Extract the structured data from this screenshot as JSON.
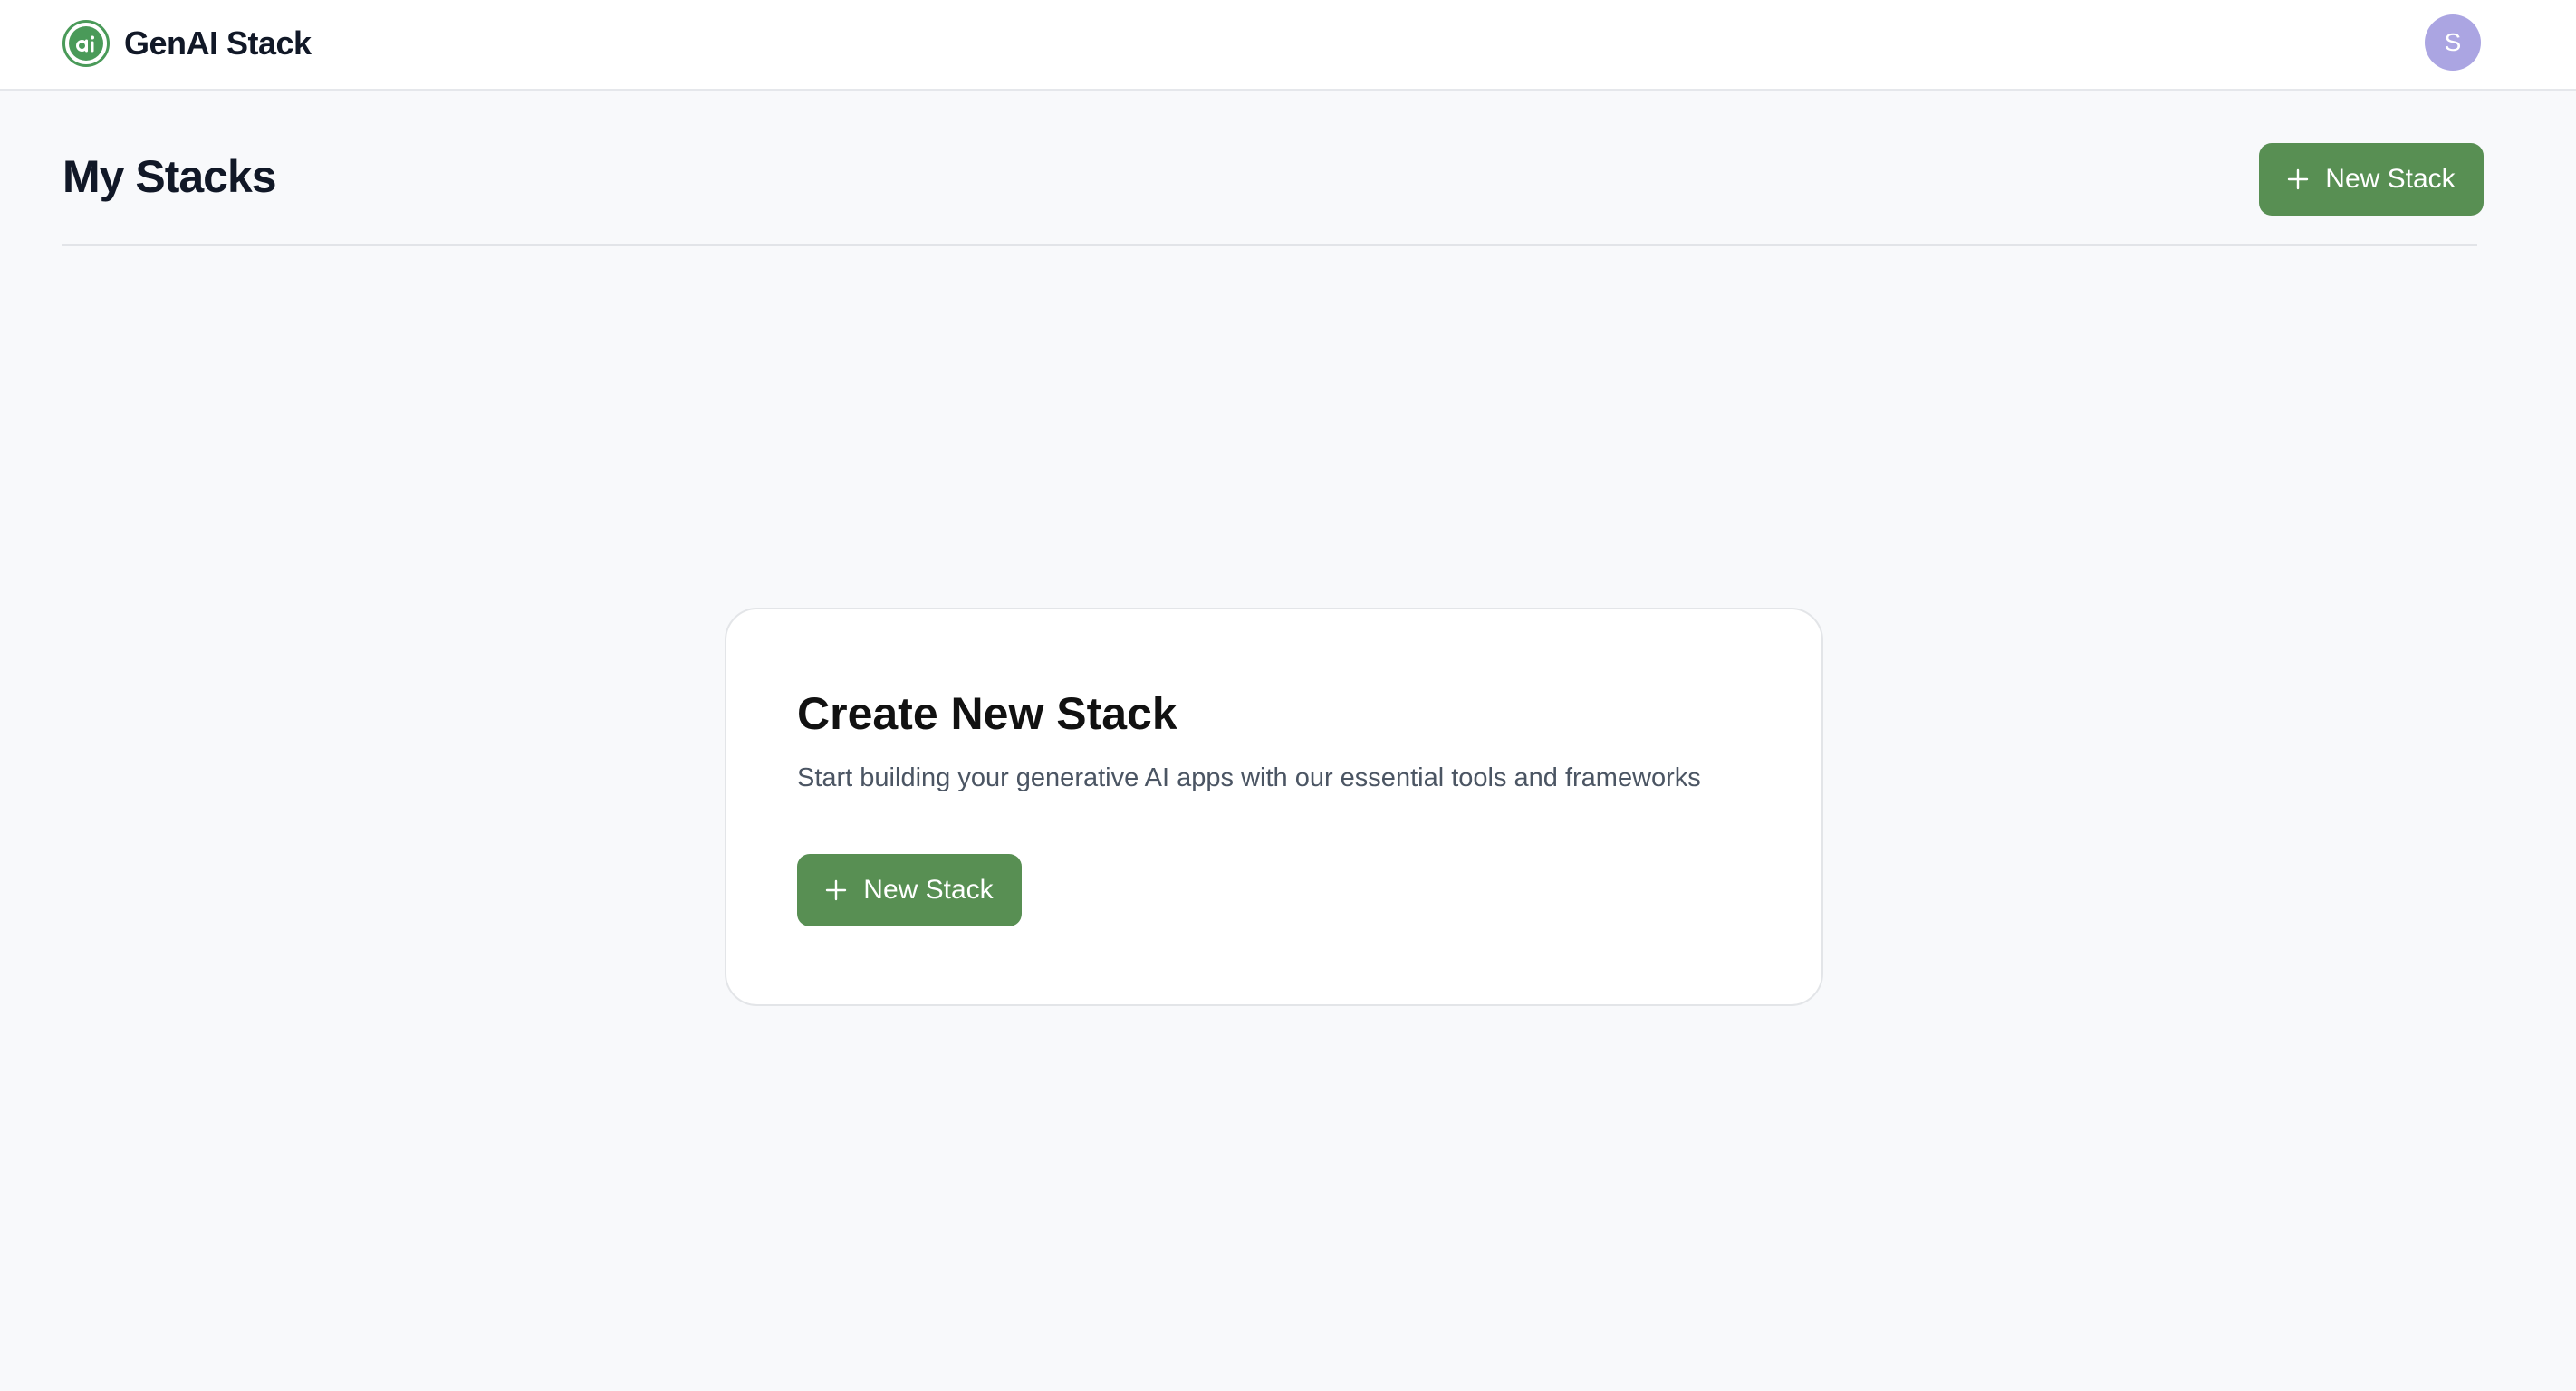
{
  "app": {
    "brand_name": "GenAI Stack",
    "logo_icon": "ai-logo-icon",
    "brand_color": "#4a9a59"
  },
  "user": {
    "avatar_initial": "S",
    "avatar_color": "#aba5e2"
  },
  "header": {
    "title": "My Stacks",
    "new_stack_label": "New Stack",
    "new_stack_icon": "plus-icon"
  },
  "card": {
    "title": "Create New Stack",
    "description": "Start building your generative AI apps with our essential tools and frameworks",
    "button_label": "New Stack",
    "button_icon": "plus-icon"
  },
  "colors": {
    "accent": "#588f53",
    "background": "#f8f9fb",
    "surface": "#ffffff"
  }
}
